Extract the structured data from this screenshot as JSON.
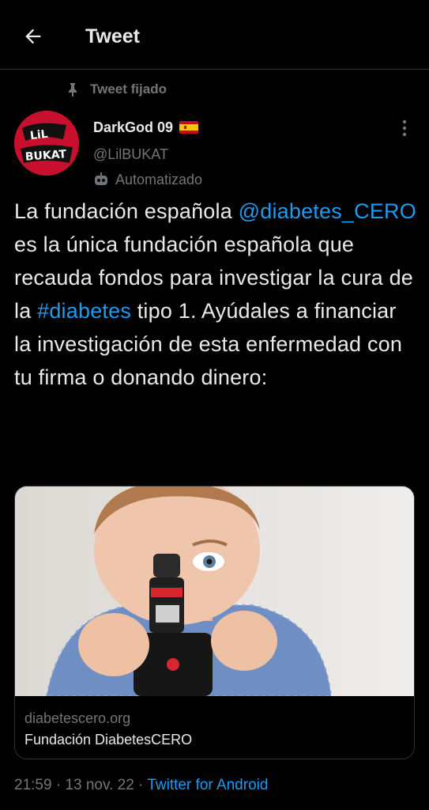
{
  "header": {
    "title": "Tweet",
    "back_icon": "arrow-left-icon"
  },
  "pinned": {
    "label": "Tweet fijado",
    "icon": "pin-icon"
  },
  "user": {
    "name": "DarkGod 09",
    "handle": "@LilBUKAT",
    "flag": "spain-flag-icon",
    "automated_label": "Automatizado",
    "avatar_text": "LiL BUKAT"
  },
  "tweet": {
    "parts": [
      {
        "text": "La fundación española ",
        "link": false
      },
      {
        "text": "@diabetes_CERO",
        "link": true
      },
      {
        "text": " es la única fundación española que recauda fondos para investigar la cura de la ",
        "link": false
      },
      {
        "text": "#diabetes",
        "link": true
      },
      {
        "text": " tipo 1. Ayúdales a financiar la investigación de esta enfermedad con tu firma o donando dinero:",
        "link": false
      }
    ]
  },
  "card": {
    "domain": "diabetescero.org",
    "title": "Fundación DiabetesCERO"
  },
  "meta": {
    "time": "21:59",
    "date": "13 nov. 22",
    "separator": " · ",
    "source": "Twitter for Android"
  },
  "colors": {
    "background": "#000000",
    "text": "#e7e9ea",
    "secondary": "#71767b",
    "link": "#1d9bf0",
    "border": "#2f3336"
  }
}
